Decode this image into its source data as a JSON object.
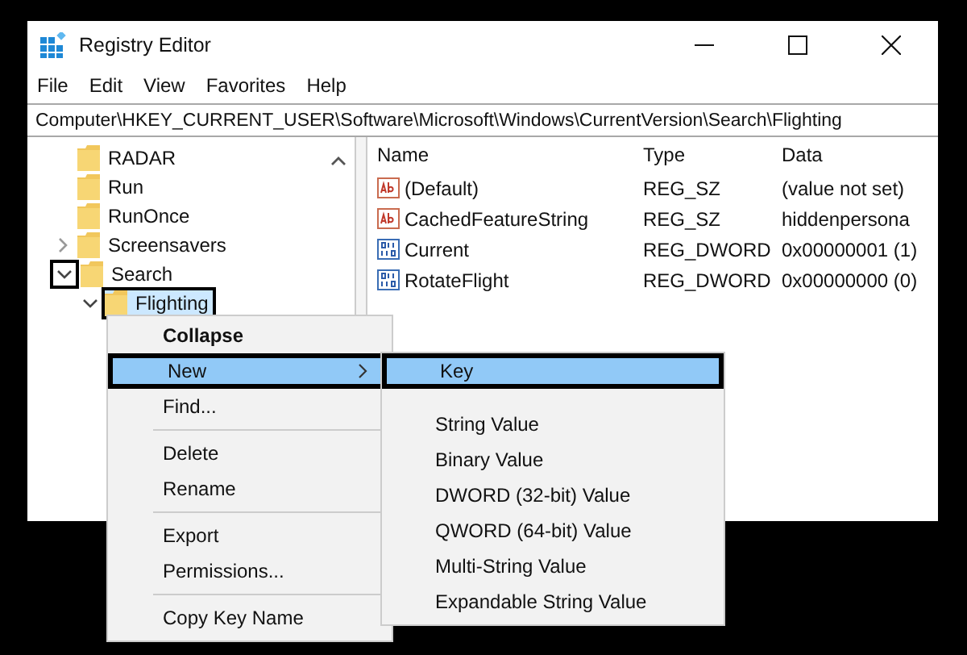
{
  "window": {
    "title": "Registry Editor"
  },
  "menu_bar": [
    "File",
    "Edit",
    "View",
    "Favorites",
    "Help"
  ],
  "address_bar": {
    "value": "Computer\\HKEY_CURRENT_USER\\Software\\Microsoft\\Windows\\CurrentVersion\\Search\\Flighting"
  },
  "tree": [
    {
      "label": "RADAR",
      "selected": false
    },
    {
      "label": "Run",
      "selected": false
    },
    {
      "label": "RunOnce",
      "selected": false
    },
    {
      "label": "Screensavers",
      "selected": false,
      "expanded": false
    },
    {
      "label": "Search",
      "selected": false,
      "expanded": true,
      "chevron_boxed": true,
      "children": [
        {
          "label": "Flighting",
          "selected": true,
          "expanded": true,
          "label_boxed": true
        }
      ]
    }
  ],
  "table": {
    "columns": [
      "Name",
      "Type",
      "Data"
    ],
    "rows": [
      {
        "kind": "string",
        "name": "(Default)",
        "type": "REG_SZ",
        "data": "(value not set)"
      },
      {
        "kind": "string",
        "name": "CachedFeatureString",
        "type": "REG_SZ",
        "data": "hiddenpersona"
      },
      {
        "kind": "binary",
        "name": "Current",
        "type": "REG_DWORD",
        "data": "0x00000001 (1)"
      },
      {
        "kind": "binary",
        "name": "RotateFlight",
        "type": "REG_DWORD",
        "data": "0x00000000 (0)"
      }
    ]
  },
  "context_menu": [
    {
      "kind": "item",
      "label": "Collapse",
      "bold": true,
      "selected": false
    },
    {
      "kind": "item",
      "label": "New",
      "submenu": true,
      "selected": true,
      "boxed": true
    },
    {
      "kind": "item",
      "label": "Find...",
      "selected": false
    },
    {
      "kind": "separator"
    },
    {
      "kind": "item",
      "label": "Delete",
      "selected": false
    },
    {
      "kind": "item",
      "label": "Rename",
      "selected": false
    },
    {
      "kind": "separator"
    },
    {
      "kind": "item",
      "label": "Export",
      "selected": false
    },
    {
      "kind": "item",
      "label": "Permissions...",
      "selected": false
    },
    {
      "kind": "separator"
    },
    {
      "kind": "item",
      "label": "Copy Key Name",
      "selected": false
    }
  ],
  "submenu": [
    {
      "kind": "item",
      "label": "Key",
      "selected": true,
      "boxed": true
    },
    {
      "kind": "separator"
    },
    {
      "kind": "item",
      "label": "String Value",
      "selected": false
    },
    {
      "kind": "item",
      "label": "Binary Value",
      "selected": false
    },
    {
      "kind": "item",
      "label": "DWORD (32-bit) Value",
      "selected": false
    },
    {
      "kind": "item",
      "label": "QWORD (64-bit) Value",
      "selected": false
    },
    {
      "kind": "item",
      "label": "Multi-String Value",
      "selected": false
    },
    {
      "kind": "item",
      "label": "Expandable String Value",
      "selected": false
    }
  ]
}
